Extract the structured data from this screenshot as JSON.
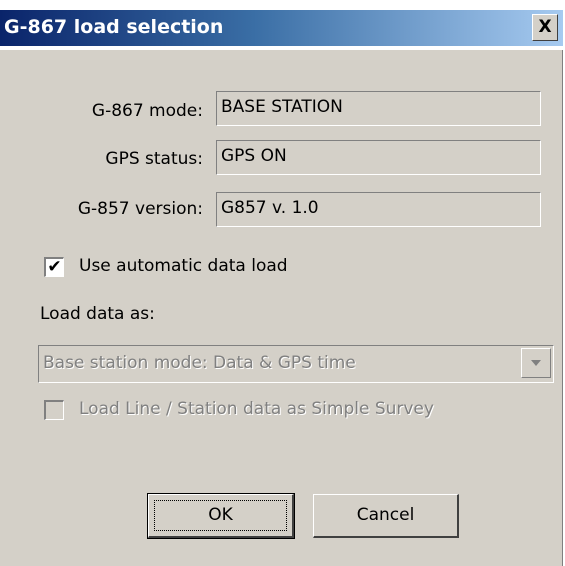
{
  "window": {
    "title": "G-867 load selection",
    "close_glyph": "X"
  },
  "fields": [
    {
      "label": "G-867 mode:",
      "value": "BASE STATION"
    },
    {
      "label": "GPS status:",
      "value": "GPS ON"
    },
    {
      "label": "G-857 version:",
      "value": "G857 v. 1.0"
    }
  ],
  "auto_load": {
    "label": "Use automatic data load",
    "checked": true
  },
  "load_as": {
    "label": "Load data as:",
    "selected": "Base station mode:  Data &  GPS time",
    "enabled": false
  },
  "simple_survey": {
    "label": "Load Line / Station data as Simple Survey",
    "checked": false,
    "enabled": false
  },
  "buttons": {
    "ok": "OK",
    "cancel": "Cancel"
  },
  "colors": {
    "title_gradient_start": "#0a246a",
    "title_gradient_end": "#a6caf0",
    "dialog_face": "#d4d0c8",
    "disabled_text": "#808080"
  }
}
